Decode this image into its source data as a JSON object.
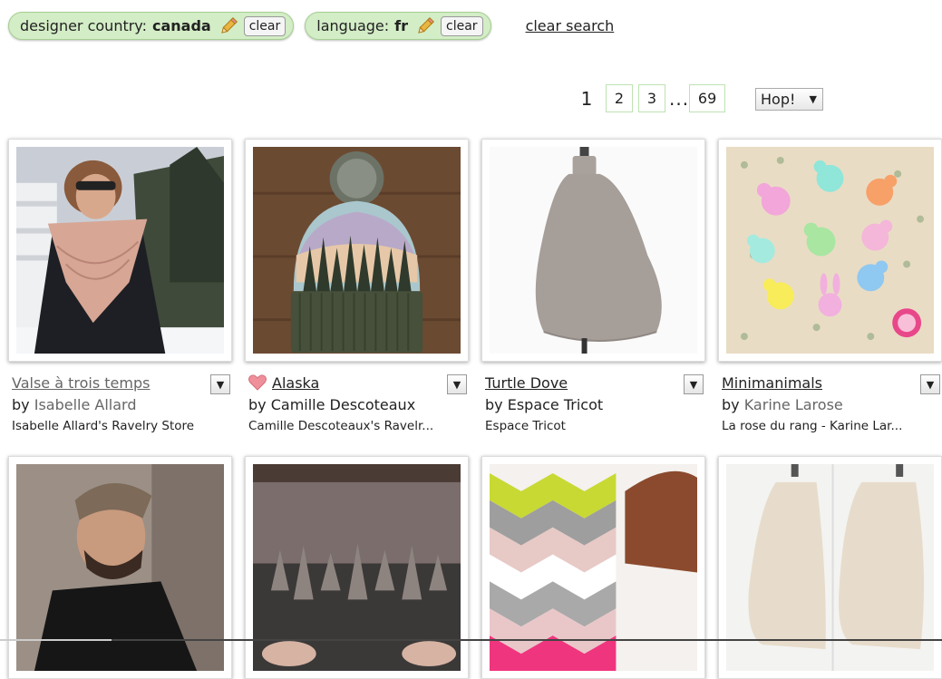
{
  "filters": [
    {
      "label": "designer country:",
      "value": "canada",
      "clear": "clear"
    },
    {
      "label": "language:",
      "value": "fr",
      "clear": "clear"
    }
  ],
  "clear_search": "clear search",
  "pagination": {
    "current": "1",
    "pages": [
      "2",
      "3"
    ],
    "ellipsis": "...",
    "last": "69"
  },
  "jump": {
    "label": "Hop!"
  },
  "patterns": [
    {
      "title": "Valse à trois temps",
      "by": "by",
      "designer": "Isabelle Allard",
      "store": "Isabelle Allard's Ravelry Store",
      "favorite": false
    },
    {
      "title": "Alaska",
      "by": "by",
      "designer": "Camille Descoteaux",
      "store": "Camille Descoteaux's Ravelr...",
      "favorite": true
    },
    {
      "title": "Turtle Dove",
      "by": "by",
      "designer": "Espace Tricot",
      "store": "Espace Tricot",
      "favorite": false
    },
    {
      "title": "Minimanimals",
      "by": "by",
      "designer": "Karine Larose",
      "store": "La rose du rang - Karine Lar...",
      "favorite": false
    }
  ]
}
